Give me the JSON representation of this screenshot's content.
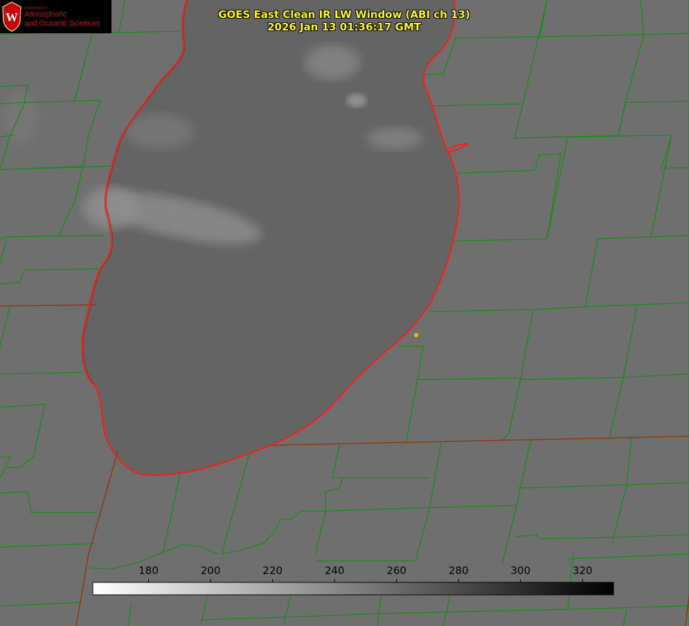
{
  "logo": {
    "emblem": "W",
    "department": "Department of",
    "line1": "Atmospheric",
    "line2": "and Oceanic Sciences"
  },
  "title": {
    "line1": "GOES East Clean IR LW Window (ABI ch 13)",
    "line2": "2026 Jan 13 01:36:17 GMT"
  },
  "colorbar": {
    "ticks": [
      "180",
      "200",
      "220",
      "240",
      "260",
      "280",
      "300",
      "320"
    ],
    "tick_values": [
      180,
      200,
      220,
      240,
      260,
      280,
      300,
      320
    ],
    "range": [
      162,
      330
    ],
    "scale": "white-to-black"
  },
  "colors": {
    "county_lines": "#1a8a1a",
    "state_lines": "#8a3a10",
    "lake_shore": "#ff1a1a",
    "title_text": "#ffff00",
    "logo_red": "#c5050c",
    "land_gray": "#6e6e6e",
    "lake_gray": "#636363"
  }
}
